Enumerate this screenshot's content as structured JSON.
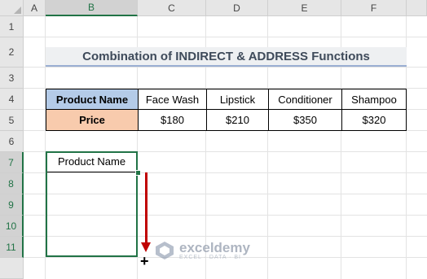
{
  "sheet": {
    "columns": [
      "A",
      "B",
      "C",
      "D",
      "E",
      "F"
    ],
    "rows": [
      "1",
      "2",
      "3",
      "4",
      "5",
      "6",
      "7",
      "8",
      "9",
      "10",
      "11"
    ],
    "selected_column": "B",
    "selected_rows": [
      "7",
      "8",
      "9",
      "10",
      "11"
    ]
  },
  "title": "Combination of INDIRECT & ADDRESS Functions",
  "table": {
    "header_label": "Product Name",
    "products": [
      "Face Wash",
      "Lipstick",
      "Conditioner",
      "Shampoo"
    ],
    "price_label": "Price",
    "prices": [
      "$180",
      "$210",
      "$350",
      "$320"
    ]
  },
  "output": {
    "header": "Product Name"
  },
  "watermark": {
    "name": "exceldemy",
    "tagline": "EXCEL · DATA · BI"
  },
  "colors": {
    "accent_green": "#217346",
    "arrow_red": "#c00000",
    "header_blue": "#b4cbe8",
    "header_orange": "#f8cbad"
  }
}
